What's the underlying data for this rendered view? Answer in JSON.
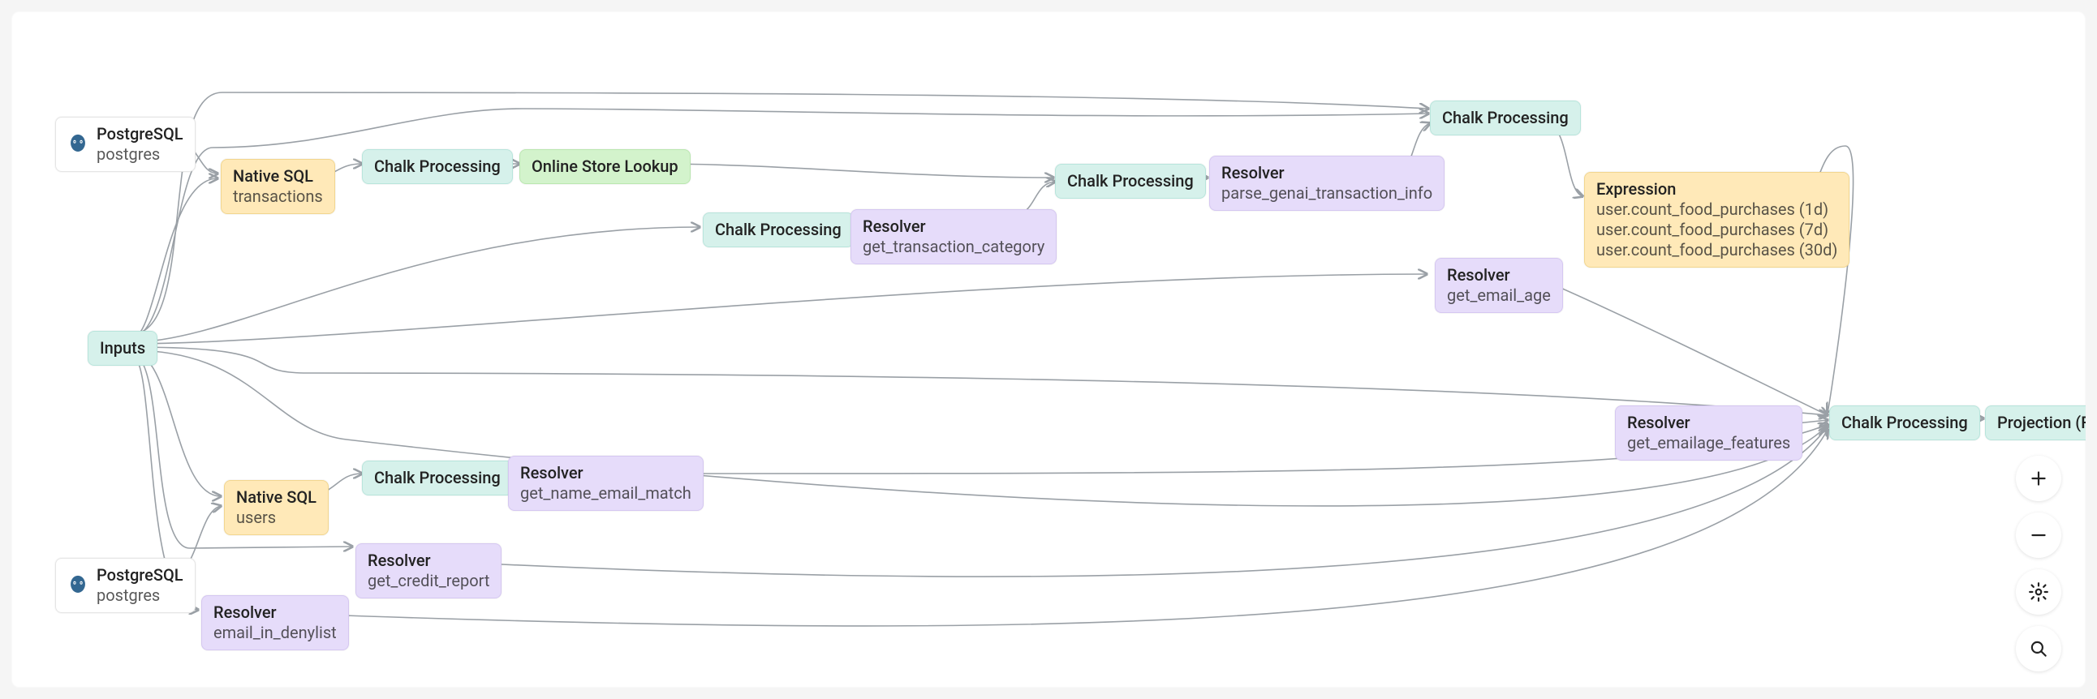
{
  "nodes": {
    "postgres_top": {
      "title": "PostgreSQL",
      "sub": "postgres"
    },
    "postgres_bottom": {
      "title": "PostgreSQL",
      "sub": "postgres"
    },
    "inputs": {
      "title": "Inputs"
    },
    "sql_tx": {
      "title": "Native SQL",
      "sub": "transactions"
    },
    "sql_users": {
      "title": "Native SQL",
      "sub": "users"
    },
    "cp1": {
      "title": "Chalk Processing"
    },
    "cp2": {
      "title": "Chalk Processing"
    },
    "cp3": {
      "title": "Chalk Processing"
    },
    "cp4": {
      "title": "Chalk Processing"
    },
    "cp5": {
      "title": "Chalk Processing"
    },
    "cp6": {
      "title": "Chalk Processing"
    },
    "online_store": {
      "title": "Online Store Lookup"
    },
    "res_tx_cat": {
      "title": "Resolver",
      "sub": "get_transaction_category"
    },
    "res_parse": {
      "title": "Resolver",
      "sub": "parse_genai_transaction_info"
    },
    "res_email_age": {
      "title": "Resolver",
      "sub": "get_email_age"
    },
    "res_emailage": {
      "title": "Resolver",
      "sub": "get_emailage_features"
    },
    "res_name_email": {
      "title": "Resolver",
      "sub": "get_name_email_match"
    },
    "res_credit": {
      "title": "Resolver",
      "sub": "get_credit_report"
    },
    "res_denylist": {
      "title": "Resolver",
      "sub": "email_in_denylist"
    },
    "expression": {
      "title": "Expression",
      "lines": [
        "user.count_food_purchases (1d)",
        "user.count_food_purchases (7d)",
        "user.count_food_purchases (30d)"
      ]
    },
    "projection": {
      "title": "Projection (Final)"
    }
  },
  "toolbar": {
    "zoom_in": "Zoom in",
    "zoom_out": "Zoom out",
    "settings": "Settings",
    "search": "Search"
  }
}
